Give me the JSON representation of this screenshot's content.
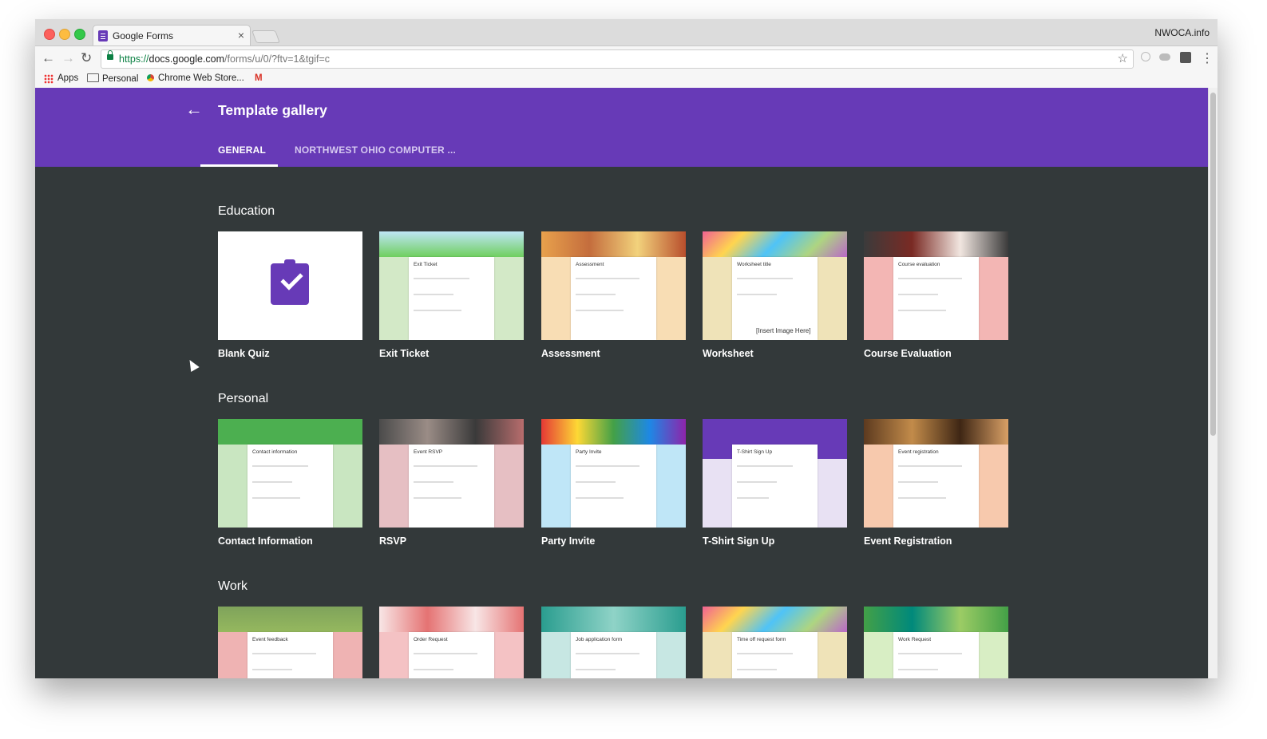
{
  "browser": {
    "tab_title": "Google Forms",
    "tab_close": "×",
    "profile_name": "NWOCA.info",
    "url_scheme": "https://",
    "url_host": "docs.google.com",
    "url_path": "/forms/u/0/?ftv=1&tgif=c",
    "nav_back": "←",
    "nav_forward": "→",
    "nav_reload": "↻",
    "star": "☆",
    "menu": "⋮",
    "bookmarks": {
      "apps": "Apps",
      "personal": "Personal",
      "chrome_web_store": "Chrome Web Store...",
      "gmail": "M"
    }
  },
  "header": {
    "back": "←",
    "title": "Template gallery",
    "tabs": [
      {
        "label": "GENERAL"
      },
      {
        "label": "NORTHWEST OHIO COMPUTER ..."
      }
    ]
  },
  "sections": [
    {
      "title": "Education",
      "cards": [
        {
          "label": "Blank Quiz"
        },
        {
          "label": "Exit Ticket",
          "form_title": "Exit Ticket"
        },
        {
          "label": "Assessment",
          "form_title": "Assessment"
        },
        {
          "label": "Worksheet",
          "form_title": "Worksheet title",
          "extra": "[Insert Image Here]"
        },
        {
          "label": "Course Evaluation",
          "form_title": "Course evaluation"
        }
      ]
    },
    {
      "title": "Personal",
      "cards": [
        {
          "label": "Contact Information",
          "form_title": "Contact information"
        },
        {
          "label": "RSVP",
          "form_title": "Event RSVP"
        },
        {
          "label": "Party Invite",
          "form_title": "Party Invite"
        },
        {
          "label": "T-Shirt Sign Up",
          "form_title": "T-Shirt Sign Up"
        },
        {
          "label": "Event Registration",
          "form_title": "Event registration"
        }
      ]
    },
    {
      "title": "Work",
      "cards": [
        {
          "form_title": "Event feedback"
        },
        {
          "form_title": "Order Request"
        },
        {
          "form_title": "Job application form"
        },
        {
          "form_title": "Time off request form"
        },
        {
          "form_title": "Work Request"
        }
      ]
    }
  ],
  "colors": {
    "brand": "#673ab7",
    "page_bg": "#33393a"
  }
}
